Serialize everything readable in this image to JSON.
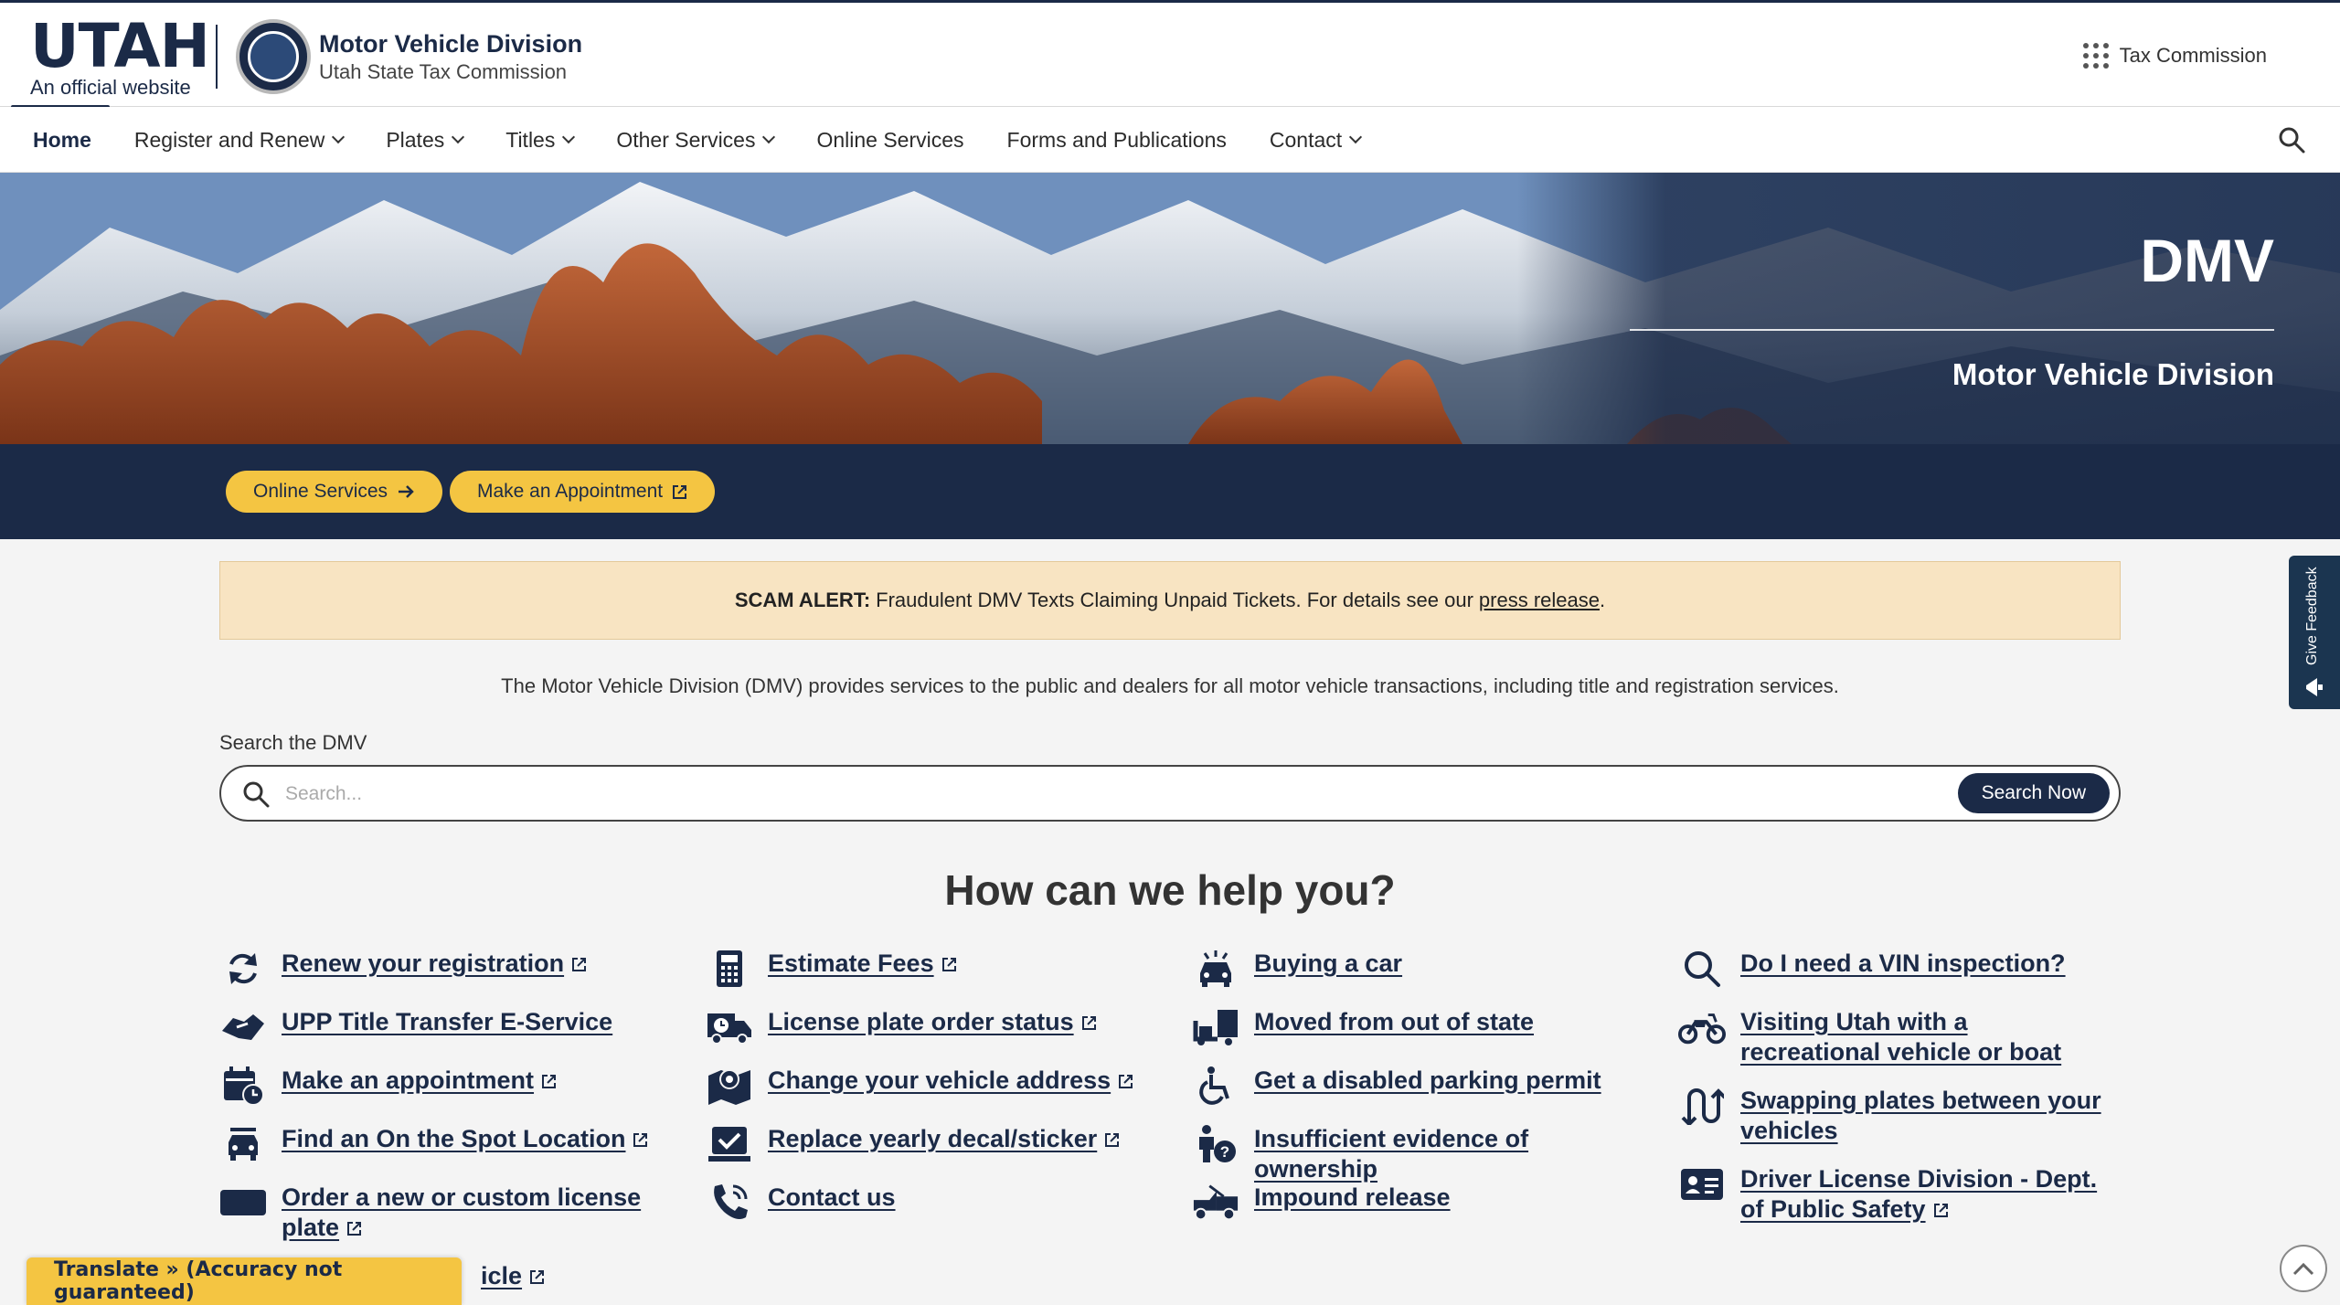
{
  "header": {
    "logo_word": "UTAH",
    "logo_sub": "An official website",
    "agency_title": "Motor Vehicle Division",
    "agency_sub": "Utah State Tax Commission",
    "tax_link": "Tax Commission"
  },
  "nav": {
    "items": [
      {
        "label": "Home"
      },
      {
        "label": "Register and Renew"
      },
      {
        "label": "Plates"
      },
      {
        "label": "Titles"
      },
      {
        "label": "Other Services"
      },
      {
        "label": "Online Services"
      },
      {
        "label": "Forms and Publications"
      },
      {
        "label": "Contact"
      }
    ]
  },
  "hero": {
    "title": "DMV",
    "subtitle": "Motor Vehicle Division"
  },
  "cta": {
    "online_services": "Online Services",
    "appointment": "Make an Appointment"
  },
  "alert": {
    "label": "SCAM ALERT:",
    "text": "Fraudulent DMV Texts Claiming Unpaid Tickets. For details see our",
    "link": "press release",
    "end": "."
  },
  "intro": "The Motor Vehicle Division (DMV) provides services to the public and dealers for all motor vehicle transactions, including title and registration services.",
  "search": {
    "label": "Search the DMV",
    "placeholder": "Search...",
    "button": "Search Now"
  },
  "help": {
    "title": "How can we help you?",
    "col1": [
      {
        "label": "Renew your registration",
        "icon": "refresh-icon"
      },
      {
        "label": "UPP Title Transfer E-Service",
        "icon": "handshake-icon"
      },
      {
        "label": "Make an appointment",
        "icon": "calendar-clock-icon"
      },
      {
        "label": "Find an On the Spot Location",
        "icon": "car-location-icon"
      },
      {
        "label": "Order a new or custom license plate",
        "icon": "license-plate-icon"
      },
      {
        "label": "icle",
        "icon": "vehicle-icon"
      }
    ],
    "col2": [
      {
        "label": "Estimate Fees",
        "icon": "calculator-icon"
      },
      {
        "label": "License plate order status",
        "icon": "truck-clock-icon"
      },
      {
        "label": "Change your vehicle address",
        "icon": "map-pin-icon"
      },
      {
        "label": "Replace yearly decal/sticker",
        "icon": "sticker-check-icon"
      },
      {
        "label": "Contact us",
        "icon": "phone-icon"
      }
    ],
    "col3": [
      {
        "label": "Buying a car",
        "icon": "car-sale-icon"
      },
      {
        "label": "Moved from out of state",
        "icon": "moving-truck-icon"
      },
      {
        "label": "Get a disabled parking permit",
        "icon": "wheelchair-icon"
      },
      {
        "label": "Insufficient evidence of ownership",
        "icon": "person-question-icon"
      },
      {
        "label": "Impound release",
        "icon": "tow-truck-icon"
      }
    ],
    "col4": [
      {
        "label": "Do I need a VIN inspection?",
        "icon": "magnifier-icon"
      },
      {
        "label": "Visiting Utah with a recreational vehicle or boat",
        "icon": "motorcycle-icon"
      },
      {
        "label": "Swapping plates between your vehicles",
        "icon": "swap-icon"
      },
      {
        "label": "Driver License Division - Dept. of Public Safety",
        "icon": "id-card-icon"
      }
    ]
  },
  "translate": "Translate » (Accuracy not guaranteed)",
  "feedback": "Give Feedback",
  "colors": {
    "navy": "#1b2a47",
    "gold": "#f4c542",
    "alert_bg": "#f8e4c2"
  }
}
